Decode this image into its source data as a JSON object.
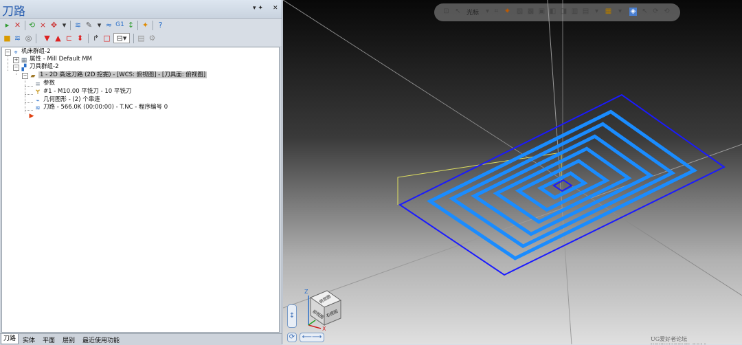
{
  "panel": {
    "title": "刀路",
    "pin_glyph": "▾ ✦",
    "close_glyph": "✕"
  },
  "tree": {
    "machine_group": "机床群组-2",
    "properties": "属性 - Mill Default MM",
    "toolpath_group": "刀具群组-2",
    "operation": "1 - 2D 高速刀路 (2D 挖掘) - [WCS: 俯视图] - [刀具面: 俯视图]",
    "params": "参数",
    "tool": "#1 - M10.00 平铣刀 - 10 平铣刀",
    "geometry": "几何图形 - (2) 个串连",
    "toolpath": "刀路 - 566.0K (00:00:00) - T.NC - 程序编号 0"
  },
  "bottom_tabs": [
    "刀路",
    "实体",
    "平面",
    "层别",
    "最近使用功能"
  ],
  "viewport": {
    "cursor_label": "光标",
    "cube_faces": [
      "俯视图",
      "前视图",
      "右视图"
    ],
    "axis_labels": [
      "Z",
      "X"
    ],
    "watermark": "UG爱好者论坛 WWW.UGSNX.COM"
  },
  "colors": {
    "toolpath": "#1a8cff",
    "boundary": "#1a1aff",
    "stock_outline": "#e0e060",
    "panel_title": "#2a5fb0"
  }
}
